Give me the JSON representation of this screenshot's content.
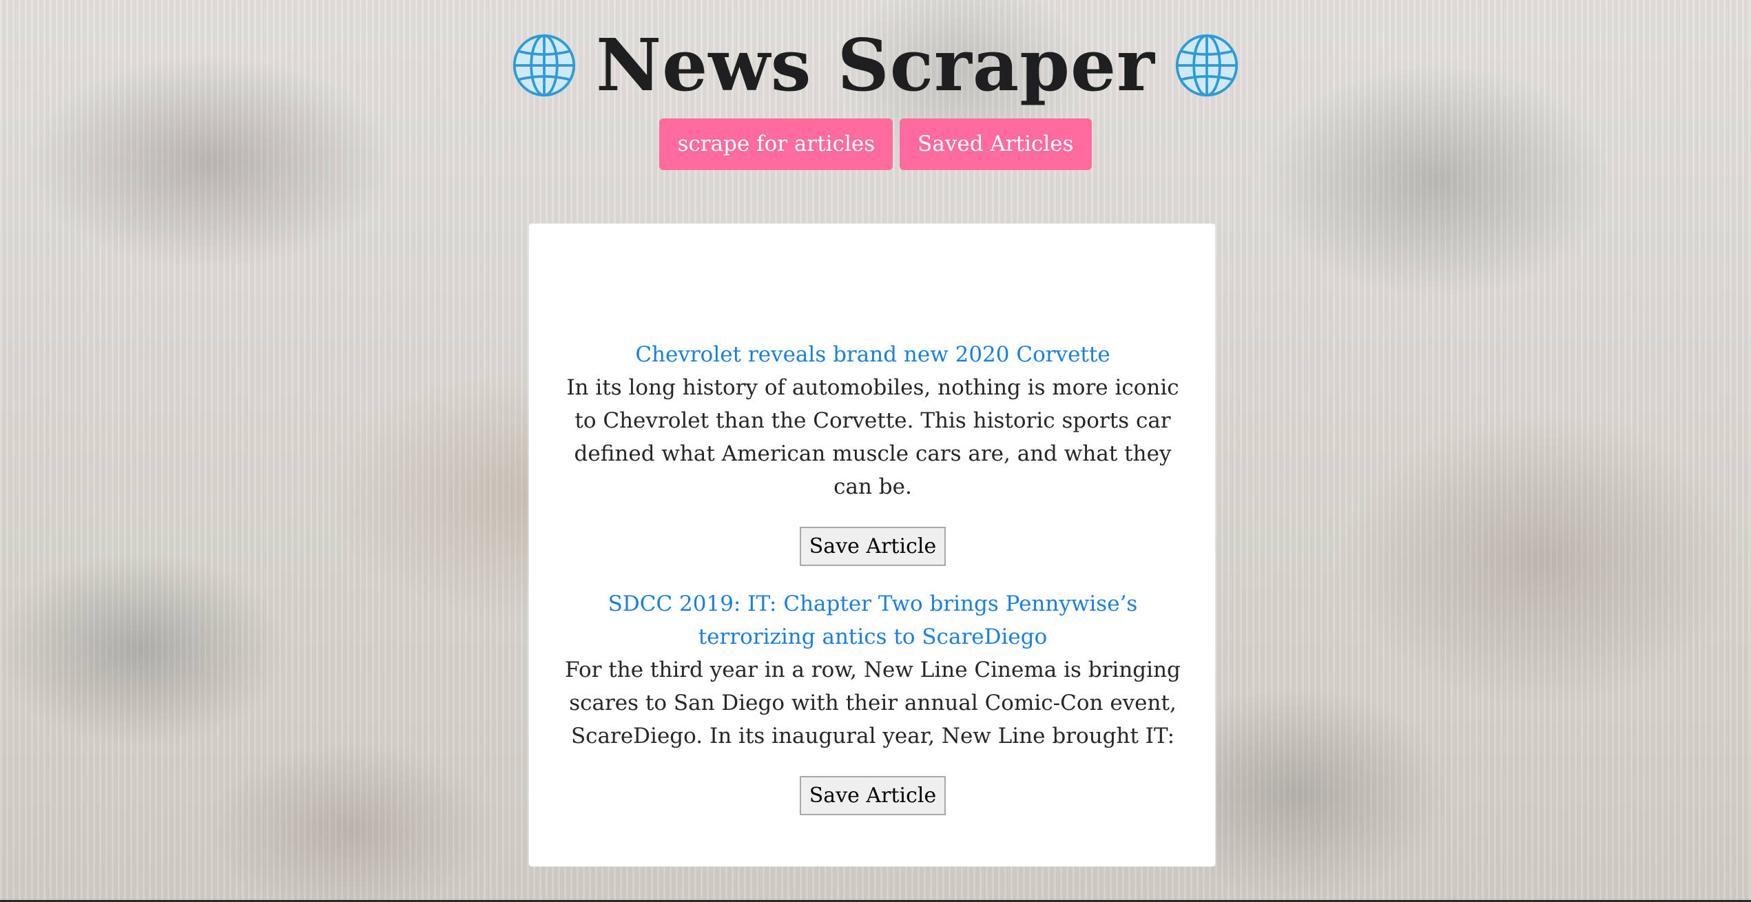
{
  "header": {
    "title": "News Scraper",
    "icon_left": "globe-icon",
    "icon_right": "globe-icon"
  },
  "nav": {
    "scrape_label": "scrape for articles",
    "saved_label": "Saved Articles"
  },
  "articles": [
    {
      "title": "Chevrolet reveals brand new 2020 Corvette",
      "summary": "In its long history of automobiles, nothing is more iconic to Chevrolet than the Corvette. This historic sports car defined what American muscle cars are, and what they can be.",
      "save_label": "Save Article"
    },
    {
      "title": "SDCC 2019: IT: Chapter Two brings Pennywise’s terrorizing antics to ScareDiego",
      "summary": "For the third year in a row, New Line Cinema is bringing scares to San Diego with their annual Comic-Con event, ScareDiego. In its inaugural year, New Line brought IT:",
      "save_label": "Save Article"
    }
  ],
  "colors": {
    "accent_pink": "#ff6b9e",
    "link_blue": "#1b7fe0",
    "title_dark": "#1f1f22"
  }
}
